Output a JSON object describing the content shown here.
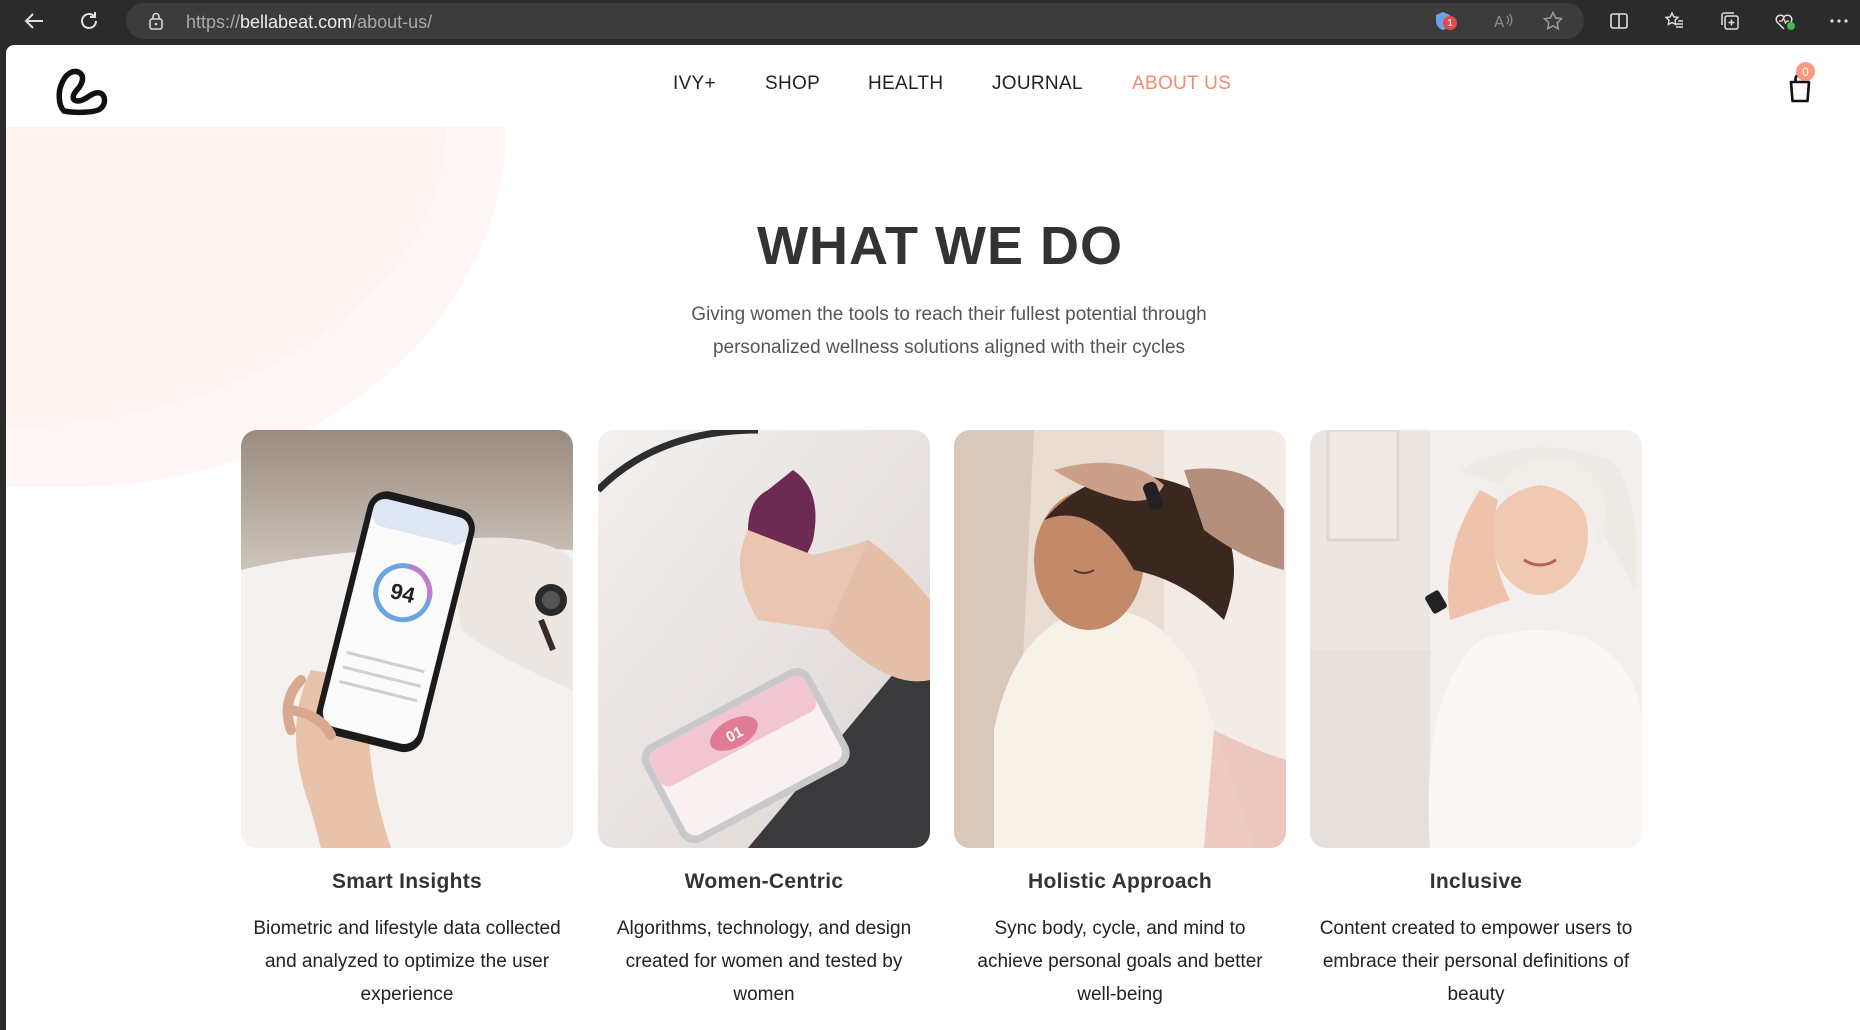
{
  "browser": {
    "url_scheme": "https://",
    "url_host": "bellabeat.com",
    "url_path": "/about-us/",
    "extension_badge": "1"
  },
  "site": {
    "nav": [
      "IVY+",
      "SHOP",
      "HEALTH",
      "JOURNAL",
      "ABOUT US"
    ],
    "active_nav": "ABOUT US",
    "accent_color": "#f28b72",
    "cart_count": "0"
  },
  "section": {
    "heading": "WHAT WE DO",
    "subtitle_line1": "Giving women the tools to reach their fullest potential through",
    "subtitle_line2": "personalized wellness solutions aligned with their cycles"
  },
  "cards": [
    {
      "title": "Smart Insights",
      "desc_lines": [
        "Biometric and lifestyle data collected",
        "and analyzed to optimize the user",
        "experience"
      ],
      "phone_score": "94"
    },
    {
      "title": "Women-Centric",
      "desc_lines": [
        "Algorithms, technology, and design",
        "created for women and tested by",
        "women"
      ],
      "phone_day": "01"
    },
    {
      "title": "Holistic Approach",
      "desc_lines": [
        "Sync body, cycle, and mind to",
        "achieve personal goals and better",
        "well-being"
      ]
    },
    {
      "title": "Inclusive",
      "desc_lines": [
        "Content created to empower users to",
        "embrace their personal definitions of",
        "beauty"
      ]
    }
  ]
}
